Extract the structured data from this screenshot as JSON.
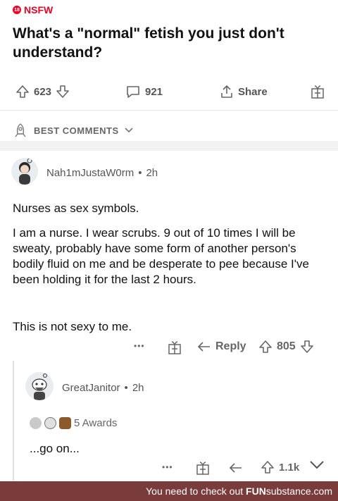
{
  "post": {
    "nsfw_label": "NSFW",
    "title": "What's a \"normal\" fetish you just don't understand?",
    "upvotes": "623",
    "comments": "921",
    "share_label": "Share"
  },
  "sort": {
    "label": "BEST COMMENTS"
  },
  "comment1": {
    "username": "Nah1mJustaW0rm",
    "time": "2h",
    "paragraphs": [
      "Nurses as sex symbols.",
      "I am a nurse. I wear scrubs. 9 out of 10 times I will be sweaty, probably have some form of another person's bodily fluid on me and be desperate to pee because I've been holding it for the last 2 hours.",
      "This is not sexy to me."
    ],
    "more": "•••",
    "reply_label": "Reply",
    "votes": "805"
  },
  "comment2": {
    "username": "GreatJanitor",
    "time": "2h",
    "awards_label": "5 Awards",
    "text": "...go on...",
    "more": "•••",
    "votes": "1.1k"
  },
  "footer": {
    "prefix": "You need to check out ",
    "brand_bold": "FUN",
    "brand_rest": "substance.com"
  },
  "colors": {
    "nsfw": "#ea0027",
    "footer_bg": "#7a3b3b"
  }
}
